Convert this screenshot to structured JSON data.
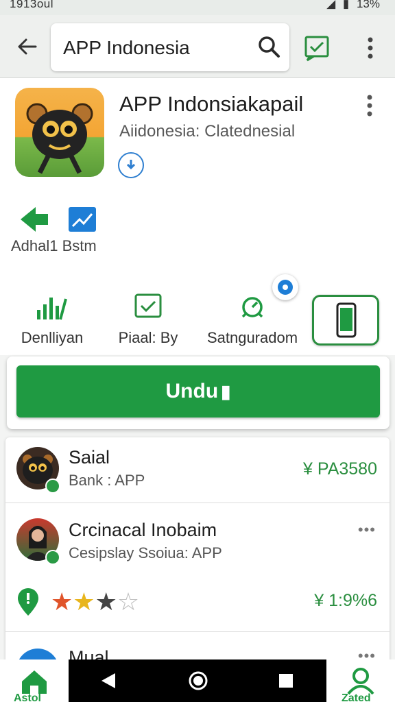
{
  "status_bar": {
    "left_text": "1913oul",
    "battery": "13%"
  },
  "search": {
    "query": "APP Indonesia"
  },
  "app": {
    "name": "APP Indonsiakapail",
    "subtitle": "Aiidonesia: Clatednesial"
  },
  "stats": {
    "label": "Adhal1 Bstm"
  },
  "features": [
    {
      "label": "Denlliyan",
      "icon": "bar-chart-icon"
    },
    {
      "label": "Piaal: By",
      "icon": "checkbox-icon"
    },
    {
      "label": "Satnguradom",
      "icon": "target-icon"
    }
  ],
  "install": {
    "label": "Undu"
  },
  "list": [
    {
      "title": "Saial",
      "subtitle": "Bank : APP",
      "price": "¥ PA3580"
    },
    {
      "title": "Crcinacal Inobaim",
      "subtitle": "Cesipslay Ssoiua: APP",
      "more": "•••",
      "price": "¥ 1:9%6",
      "rating": 3
    },
    {
      "title": "Mual",
      "more": "•••"
    }
  ],
  "bottom_nav": {
    "home": "Astol",
    "profile": "Zated"
  },
  "colors": {
    "accent": "#1f9a42",
    "blue": "#2f7fd0"
  }
}
